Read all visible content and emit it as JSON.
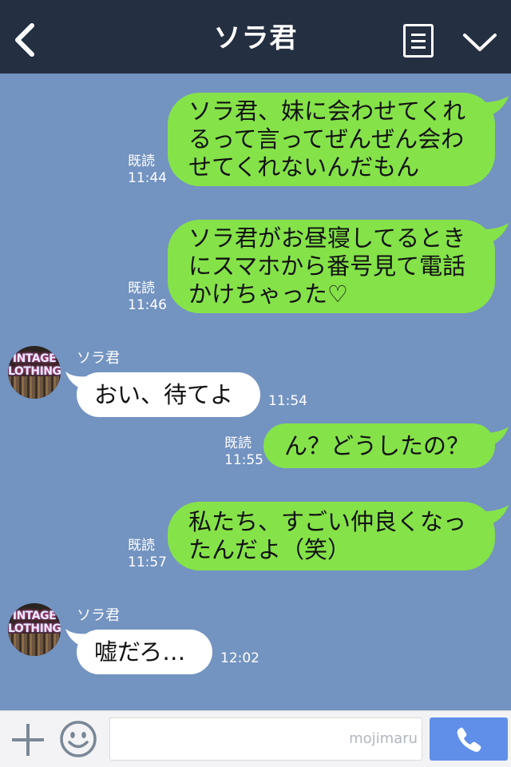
{
  "header": {
    "title": "ソラ君",
    "back_icon": "chevron-left-icon",
    "notes_icon": "note-icon",
    "menu_icon": "chevron-down-icon"
  },
  "messages": [
    {
      "side": "out",
      "read": "既読",
      "time": "11:44",
      "lines": [
        "ソラ君、妹に会わせてくれ",
        "るって言ってぜんぜん会わ",
        "せてくれないんだもん"
      ]
    },
    {
      "side": "out",
      "read": "既読",
      "time": "11:46",
      "lines": [
        "ソラ君がお昼寝してるとき",
        "にスマホから番号見て電話",
        "かけちゃった♡"
      ]
    },
    {
      "side": "in",
      "sender": "ソラ君",
      "time": "11:54",
      "text": "おい、待てよ"
    },
    {
      "side": "out",
      "read": "既読",
      "time": "11:55",
      "text": "ん？どうしたの？"
    },
    {
      "side": "out",
      "read": "既読",
      "time": "11:57",
      "lines": [
        "私たち、すごい仲良くなっ",
        "たんだよ（笑）"
      ]
    },
    {
      "side": "in",
      "sender": "ソラ君",
      "time": "12:02",
      "text": "嘘だろ…"
    }
  ],
  "avatar": {
    "sign_lines": [
      "INTAGE",
      "LOTHING"
    ]
  },
  "input": {
    "value": "",
    "watermark": "mojimaru"
  },
  "colors": {
    "header": "#252f42",
    "background": "#7393c1",
    "outgoing": "#85e249",
    "incoming": "#ffffff",
    "call": "#5f8fe9"
  }
}
